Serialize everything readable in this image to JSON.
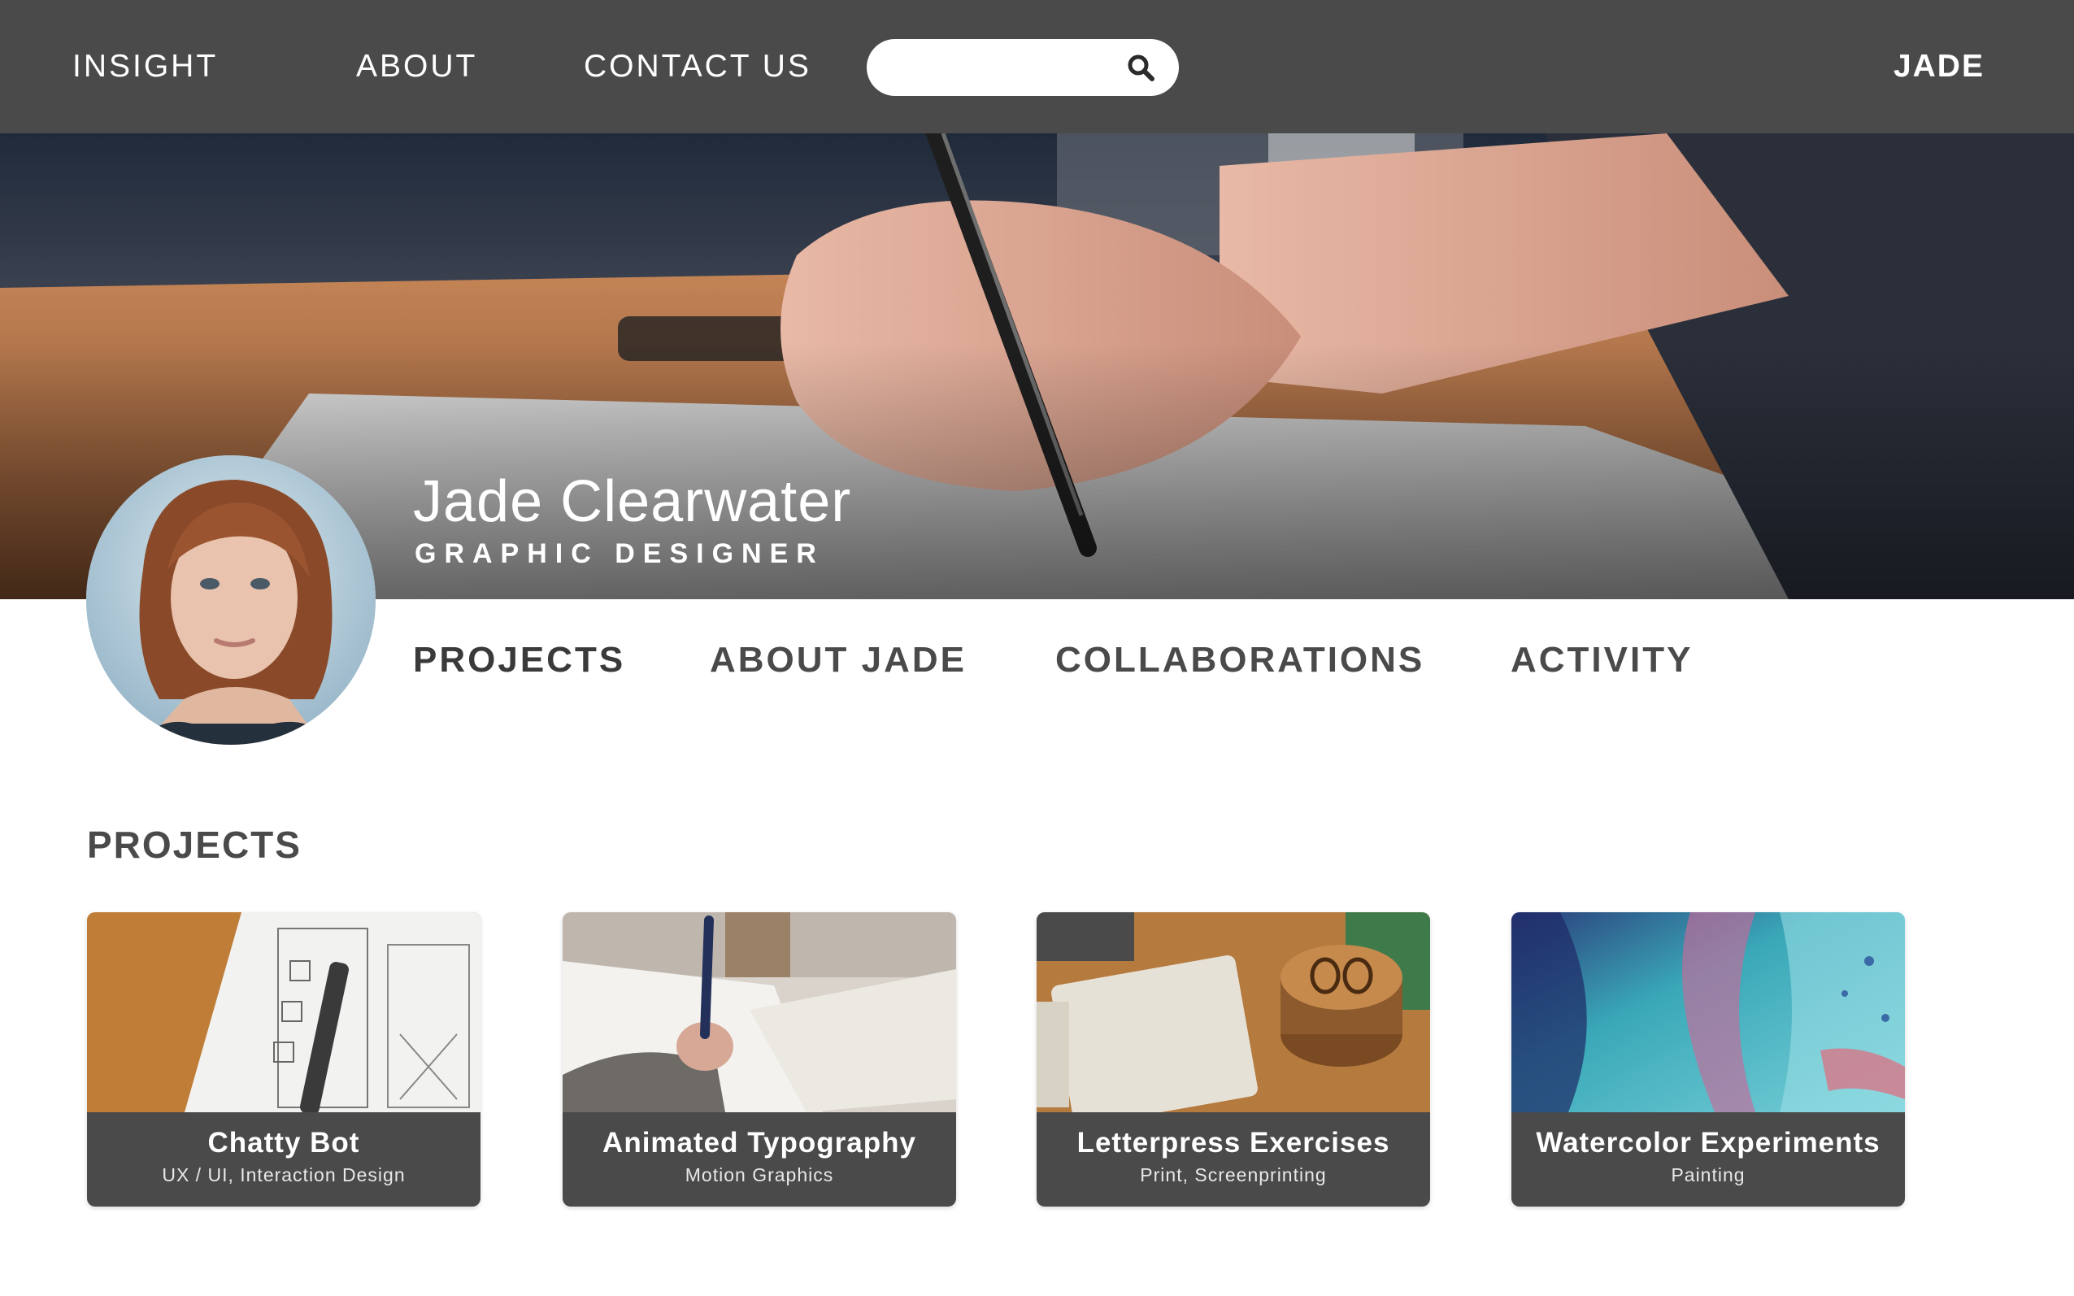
{
  "nav": {
    "links": [
      "INSIGHT",
      "ABOUT",
      "CONTACT US"
    ],
    "search": {
      "value": "",
      "placeholder": "",
      "icon": "search-icon"
    },
    "user": "JADE",
    "background": "#4a4a4a"
  },
  "profile": {
    "name": "Jade Clearwater",
    "title": "GRAPHIC DESIGNER",
    "hero_image": "hand-writing-with-pen",
    "avatar": "portrait-red-hair"
  },
  "tabs": [
    "PROJECTS",
    "ABOUT JADE",
    "COLLABORATIONS",
    "ACTIVITY"
  ],
  "projects": {
    "heading": "PROJECTS",
    "items": [
      {
        "title": "Chatty Bot",
        "subtitle": "UX / UI, Interaction Design",
        "image": "wireframe-sketch"
      },
      {
        "title": "Animated Typography",
        "subtitle": "Motion Graphics",
        "image": "writing-notebook"
      },
      {
        "title": "Letterpress Exercises",
        "subtitle": "Print, Screenprinting",
        "image": "letterpress-coasters"
      },
      {
        "title": "Watercolor Experiments",
        "subtitle": "Painting",
        "image": "watercolor-abstract"
      }
    ]
  }
}
